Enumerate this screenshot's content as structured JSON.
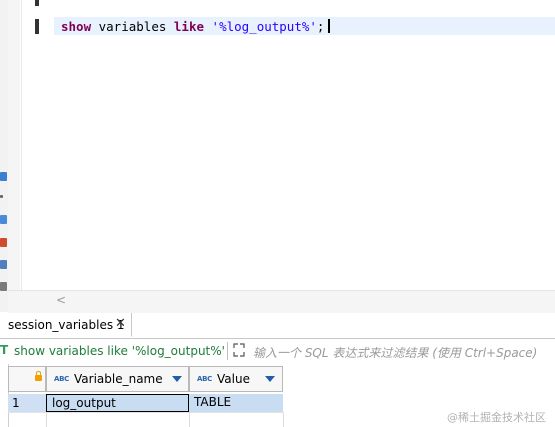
{
  "editor": {
    "sql": {
      "kw1": "show",
      "word": " variables ",
      "kw2": "like",
      "str": " '%log_output%'",
      "semi": ";"
    }
  },
  "results_tab": {
    "label": "session_variables 1",
    "close": "✕"
  },
  "filter": {
    "marker": "T",
    "query": "show variables like '%log_output%'",
    "placeholder": "输入一个 SQL 表达式来过滤结果 (使用 Ctrl+Space)"
  },
  "grid": {
    "columns": [
      {
        "type_badge": "ABC",
        "name": "Variable_name"
      },
      {
        "type_badge": "ABC",
        "name": "Value"
      }
    ],
    "rows": [
      {
        "num": "1",
        "cells": [
          "log_output",
          "TABLE"
        ]
      }
    ]
  },
  "scroll": {
    "left_arrow": "<"
  },
  "watermark": "@稀土掘金技术社区",
  "colors": {
    "keyword": "#7f0055",
    "string": "#2a00ff",
    "filter_text": "#1e7c3a",
    "selection": "#c8dcf2"
  }
}
